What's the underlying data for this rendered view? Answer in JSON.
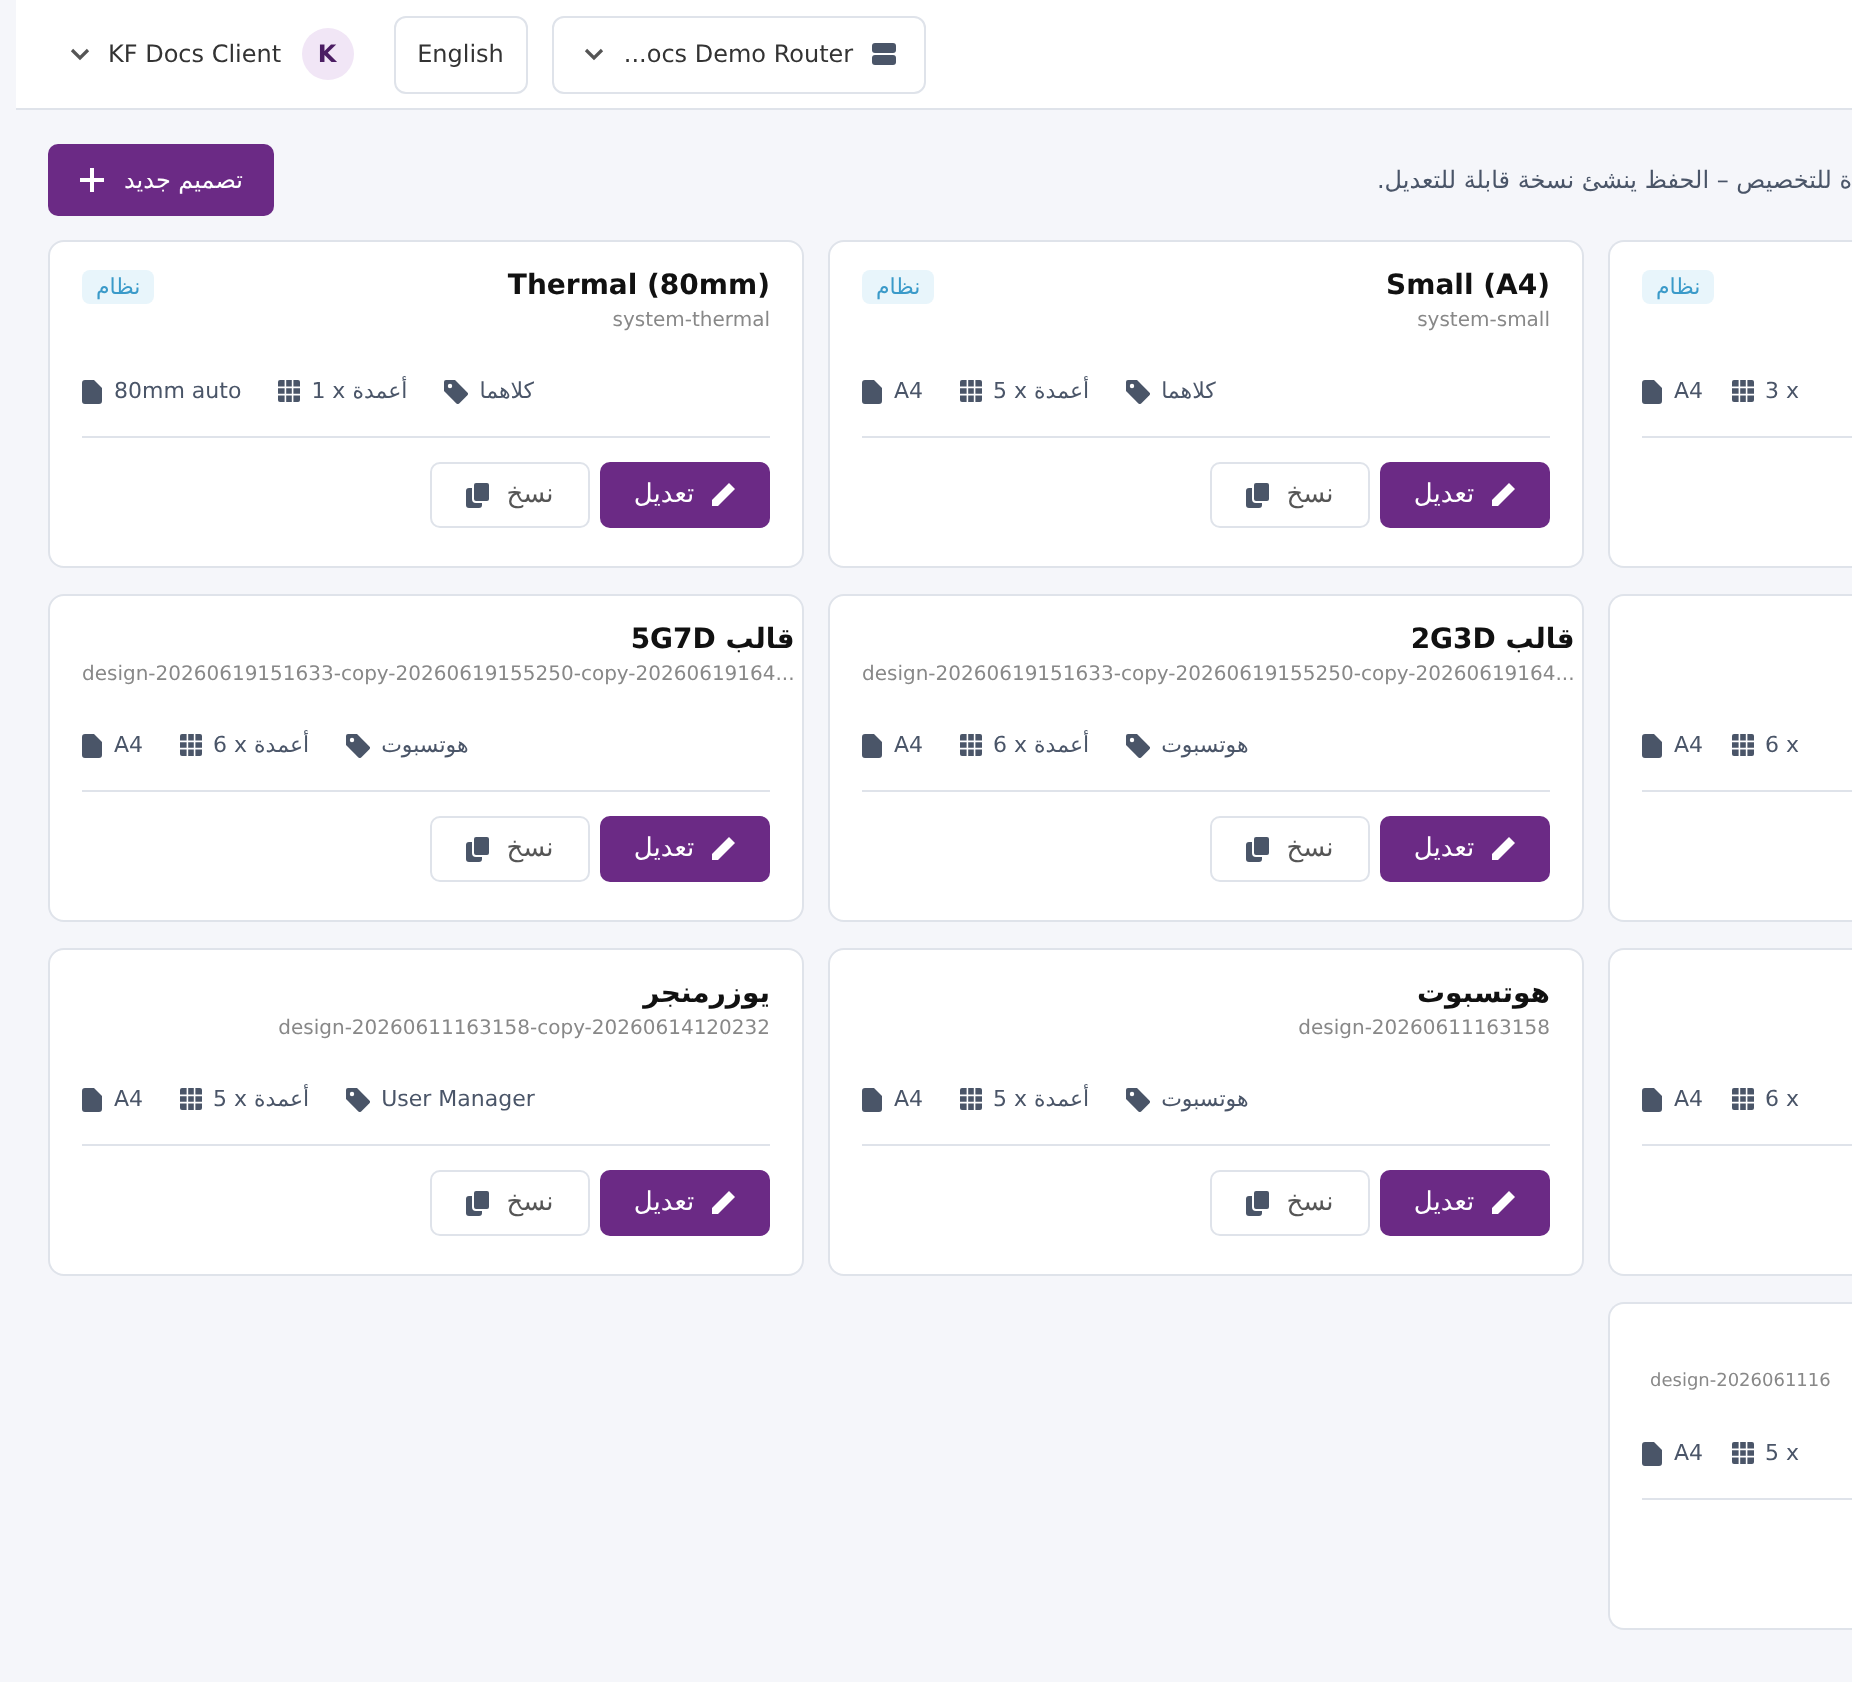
{
  "header": {
    "account": {
      "name": "KF Docs Client",
      "avatar": "K"
    },
    "language": "English",
    "router": "...ocs Demo Router"
  },
  "toolbar": {
    "new_button": "تصميم جديد",
    "hint": "ة للتخصيص – الحفظ ينشئ نسخة قابلة للتعديل."
  },
  "rows": [
    [
      {
        "kind": "partial",
        "badge": "نظام",
        "meta": {
          "size": "A4",
          "columns": "3 x"
        }
      },
      {
        "kind": "full",
        "badge": "نظام",
        "title": "Small (A4)",
        "subtitle": "system-small",
        "meta": {
          "size": "A4",
          "columns": "5 x أعمدة",
          "tag": "كلاهما"
        },
        "actions": {
          "edit": "تعديل",
          "copy": "نسخ"
        }
      },
      {
        "kind": "full",
        "badge": "نظام",
        "title": "Thermal (80mm)",
        "subtitle": "system-thermal",
        "meta": {
          "size": "80mm auto",
          "columns": "1 x أعمدة",
          "tag": "كلاهما"
        },
        "actions": {
          "edit": "تعديل",
          "copy": "نسخ"
        }
      }
    ],
    [
      {
        "kind": "partial",
        "meta": {
          "size": "A4",
          "columns": "6 x"
        }
      },
      {
        "kind": "full",
        "title": "قالب 2G3D",
        "subtitle": "design-20260619151633-copy-20260619155250-copy-20260619164...",
        "meta": {
          "size": "A4",
          "columns": "6 x أعمدة",
          "tag": "هوتسبوت"
        },
        "actions": {
          "edit": "تعديل",
          "copy": "نسخ"
        }
      },
      {
        "kind": "full",
        "title": "قالب 5G7D",
        "subtitle": "design-20260619151633-copy-20260619155250-copy-20260619164...",
        "meta": {
          "size": "A4",
          "columns": "6 x أعمدة",
          "tag": "هوتسبوت"
        },
        "actions": {
          "edit": "تعديل",
          "copy": "نسخ"
        }
      }
    ],
    [
      {
        "kind": "partial",
        "meta": {
          "size": "A4",
          "columns": "6 x"
        }
      },
      {
        "kind": "full",
        "title": "هوتسبوت",
        "subtitle": "design-20260611163158",
        "meta": {
          "size": "A4",
          "columns": "5 x أعمدة",
          "tag": "هوتسبوت"
        },
        "actions": {
          "edit": "تعديل",
          "copy": "نسخ"
        }
      },
      {
        "kind": "full",
        "title": "يوزرمنجر",
        "subtitle": "design-20260611163158-copy-20260614120232",
        "meta": {
          "size": "A4",
          "columns": "5 x أعمدة",
          "tag": "User Manager"
        },
        "actions": {
          "edit": "تعديل",
          "copy": "نسخ"
        }
      }
    ],
    [
      {
        "kind": "partial",
        "subtitle": "design-2026061116",
        "meta": {
          "size": "A4",
          "columns": "5 x"
        }
      },
      null,
      null
    ]
  ]
}
